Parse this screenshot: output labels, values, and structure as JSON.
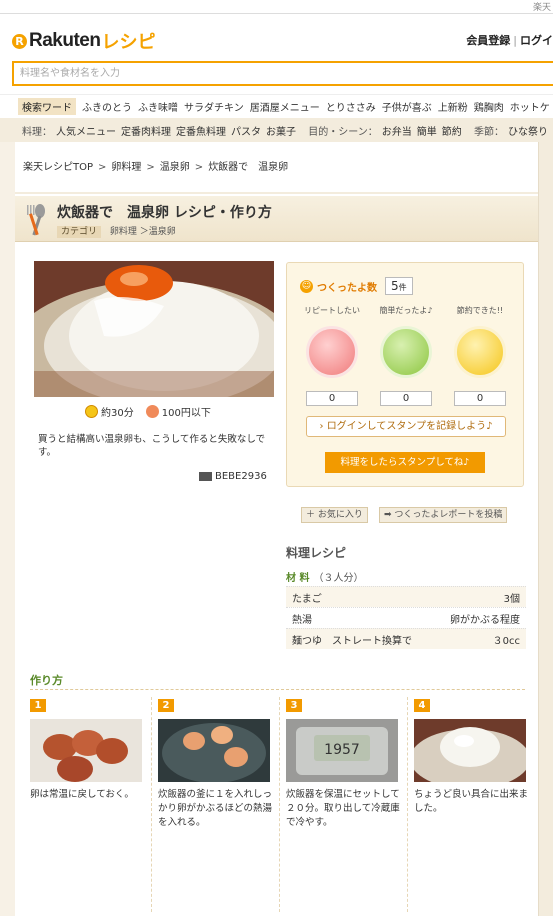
{
  "topbar": {
    "corner_text": "楽天"
  },
  "header": {
    "logo_letter": "R",
    "logo_main": "Rakuten",
    "logo_sub": "レシピ",
    "login_link": "会員登録",
    "login_link2": "ログイ",
    "search_placeholder": "料理名や食材名を入力"
  },
  "keywords": {
    "label": "検索ワード",
    "items": [
      "ふきのとう",
      "ふき味噌",
      "サラダチキン",
      "居酒屋メニュー",
      "とりささみ",
      "子供が喜ぶ",
      "上新粉",
      "鶏胸肉",
      "ホットケ"
    ]
  },
  "categories": {
    "ryori_label": "料理：",
    "ryori": [
      "人気メニュー",
      "定番肉料理",
      "定番魚料理",
      "パスタ",
      "お菓子"
    ],
    "scene_label": "目的・シーン：",
    "scene": [
      "お弁当",
      "簡単",
      "節約"
    ],
    "season_label": "季節：",
    "season": [
      "ひな祭り"
    ]
  },
  "breadcrumb": [
    "楽天レシピTOP",
    "卵料理",
    "温泉卵",
    "炊飯器で　温泉卵"
  ],
  "recipe": {
    "title": "炊飯器で　温泉卵 レシピ・作り方",
    "category_badge": "カテゴリ",
    "category_path": "卵料理 ＞温泉卵",
    "time": "約30分",
    "cost": "100円以下",
    "description": "買うと結構高い温泉卵も、こうして作ると失敗なしです。",
    "author": "BEBE2936"
  },
  "stamps": {
    "title": "つくったよ数",
    "count": "5",
    "count_unit": "件",
    "items": [
      {
        "label": "リピートしたい",
        "value": "0",
        "color": "#f07a7a"
      },
      {
        "label": "簡単だったよ♪",
        "value": "0",
        "color": "#8cc63f"
      },
      {
        "label": "節約できた!!",
        "value": "0",
        "color": "#f5c518"
      }
    ],
    "login_button": "ログインしてスタンプを記録しよう♪",
    "cta": "料理をしたらスタンプしてね♪"
  },
  "actions": {
    "favorite": "お気に入り",
    "report": "つくったよレポートを投稿"
  },
  "ingredients": {
    "heading": "料理レシピ",
    "label": "材 料",
    "servings": "（３人分）",
    "rows": [
      {
        "name": "たまご",
        "amount": "3個"
      },
      {
        "name": "熱湯",
        "amount": "卵がかぶる程度"
      },
      {
        "name": "麺つゆ　ストレート換算で",
        "amount": "３0cc"
      }
    ]
  },
  "steps": {
    "heading": "作り方",
    "items": [
      {
        "num": "1",
        "text": "卵は常温に戻しておく。"
      },
      {
        "num": "2",
        "text": "炊飯器の釜に１を入れしっかり卵がかぶるほどの熱湯を入れる。"
      },
      {
        "num": "3",
        "text": "炊飯器を保温にセットして２０分。取り出して冷蔵庫で冷やす。"
      },
      {
        "num": "4",
        "text": "ちょうど良い具合に出来ました。"
      }
    ]
  }
}
